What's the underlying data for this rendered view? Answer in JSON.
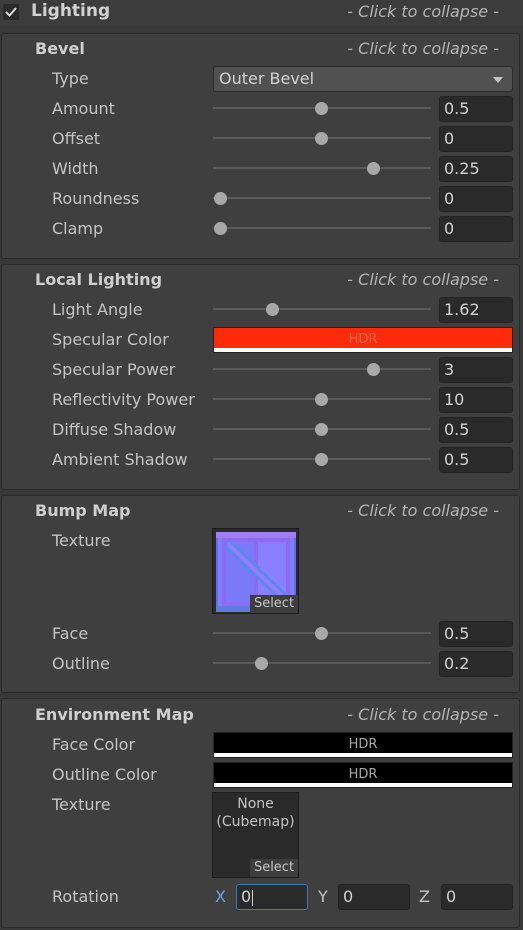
{
  "header": {
    "title": "Lighting",
    "collapse_hint": "- Click to collapse -",
    "checked": true
  },
  "bevel": {
    "title": "Bevel",
    "collapse_hint": "- Click to collapse -",
    "type_label": "Type",
    "type_value": "Outer Bevel",
    "amount": {
      "label": "Amount",
      "value": "0.5",
      "slider_fraction": 0.5
    },
    "offset": {
      "label": "Offset",
      "value": "0",
      "slider_fraction": 0.5
    },
    "width": {
      "label": "Width",
      "value": "0.25",
      "slider_fraction": 0.75
    },
    "roundness": {
      "label": "Roundness",
      "value": "0",
      "slider_fraction": 0
    },
    "clamp": {
      "label": "Clamp",
      "value": "0",
      "slider_fraction": 0
    }
  },
  "local_lighting": {
    "title": "Local Lighting",
    "collapse_hint": "- Click to collapse -",
    "light_angle": {
      "label": "Light Angle",
      "value": "1.62",
      "slider_fraction": 0.26
    },
    "specular_color": {
      "label": "Specular Color",
      "hdr_label": "HDR",
      "color": "#ff2a0a"
    },
    "specular_power": {
      "label": "Specular Power",
      "value": "3",
      "slider_fraction": 0.75
    },
    "reflectivity_power": {
      "label": "Reflectivity Power",
      "value": "10",
      "slider_fraction": 0.5
    },
    "diffuse_shadow": {
      "label": "Diffuse Shadow",
      "value": "0.5",
      "slider_fraction": 0.5
    },
    "ambient_shadow": {
      "label": "Ambient Shadow",
      "value": "0.5",
      "slider_fraction": 0.5
    }
  },
  "bump_map": {
    "title": "Bump Map",
    "collapse_hint": "- Click to collapse -",
    "texture_label": "Texture",
    "select_label": "Select",
    "face": {
      "label": "Face",
      "value": "0.5",
      "slider_fraction": 0.5
    },
    "outline": {
      "label": "Outline",
      "value": "0.2",
      "slider_fraction": 0.2
    }
  },
  "environment_map": {
    "title": "Environment Map",
    "collapse_hint": "- Click to collapse -",
    "face_color": {
      "label": "Face Color",
      "hdr_label": "HDR",
      "color": "#000000"
    },
    "outline_color": {
      "label": "Outline Color",
      "hdr_label": "HDR",
      "color": "#000000"
    },
    "texture_label": "Texture",
    "texture_none": "None",
    "texture_type": "(Cubemap)",
    "select_label": "Select",
    "rotation": {
      "label": "Rotation",
      "x_label": "X",
      "x_value": "0",
      "y_label": "Y",
      "y_value": "0",
      "z_label": "Z",
      "z_value": "0"
    }
  },
  "colors": {
    "background": "#383838",
    "panel": "#3f3f3f",
    "field": "#2a2a2a",
    "focus_accent": "#3a79bb",
    "axis_x": "#6aa6e8"
  }
}
